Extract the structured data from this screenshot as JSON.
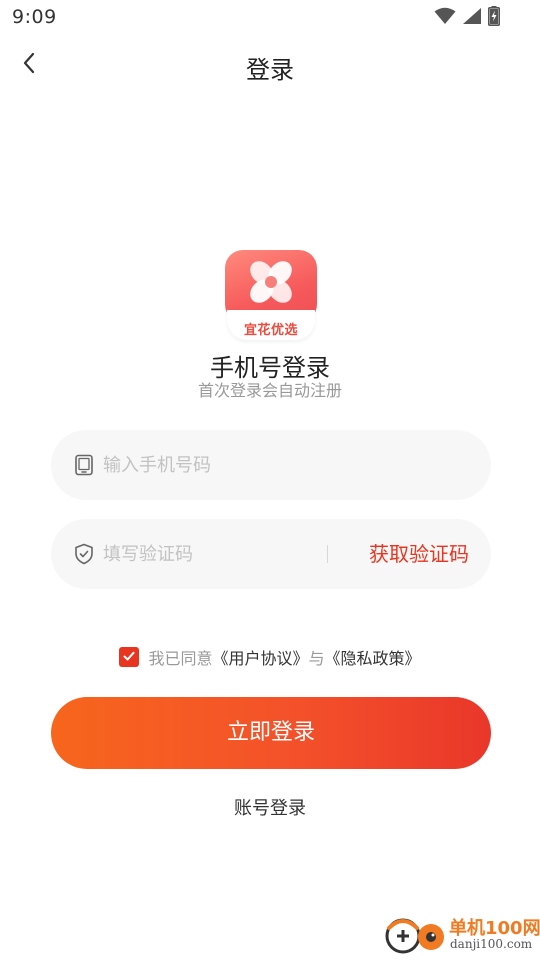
{
  "status_bar": {
    "time": "9:09",
    "icons": [
      "wifi-icon",
      "signal-icon",
      "battery-charging-icon"
    ]
  },
  "header": {
    "back_icon": "chevron-left-icon",
    "title": "登录"
  },
  "logo": {
    "text": "宜花优选",
    "colors": {
      "tile": "#f65a5b",
      "text": "#ef4a3d"
    }
  },
  "heading": {
    "title": "手机号登录",
    "subtitle": "首次登录会自动注册"
  },
  "phone_field": {
    "icon": "phone-icon",
    "placeholder": "输入手机号码",
    "value": ""
  },
  "code_field": {
    "icon": "shield-check-icon",
    "placeholder": "填写验证码",
    "value": "",
    "get_code_label": "获取验证码"
  },
  "agreement": {
    "checked": true,
    "prefix": "我已同意",
    "user_agreement": "《用户协议》",
    "conjunction": "与",
    "privacy_policy": "《隐私政策》"
  },
  "actions": {
    "login_label": "立即登录",
    "account_login_label": "账号登录"
  },
  "watermark": {
    "name": "单机100网",
    "url": "danji100.com"
  },
  "colors": {
    "accent": "#e8351f",
    "button_gradient_start": "#f7661c",
    "button_gradient_end": "#e9372a",
    "field_background": "#f7f7f7",
    "muted_text": "#999999"
  }
}
